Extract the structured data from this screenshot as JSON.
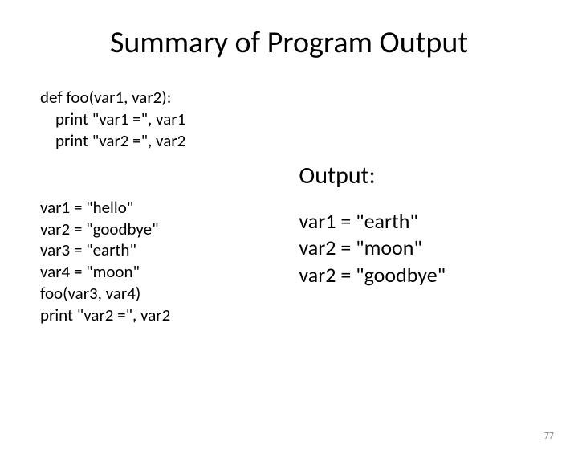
{
  "title": "Summary of Program Output",
  "code": {
    "def_line": "def foo(var1, var2):",
    "print1": "    print \"var1 =\", var1",
    "print2": "    print \"var2 =\", var2",
    "assign1": "var1 = \"hello\"",
    "assign2": "var2 = \"goodbye\"",
    "assign3": "var3 = \"earth\"",
    "assign4": "var4 = \"moon\"",
    "call": "foo(var3, var4)",
    "print3": "print \"var2 =\", var2"
  },
  "output_heading": "Output:",
  "output": {
    "line1": "var1 = \"earth\"",
    "line2": "var2 = \"moon\"",
    "line3": "var2 = \"goodbye\""
  },
  "page_number": "77"
}
